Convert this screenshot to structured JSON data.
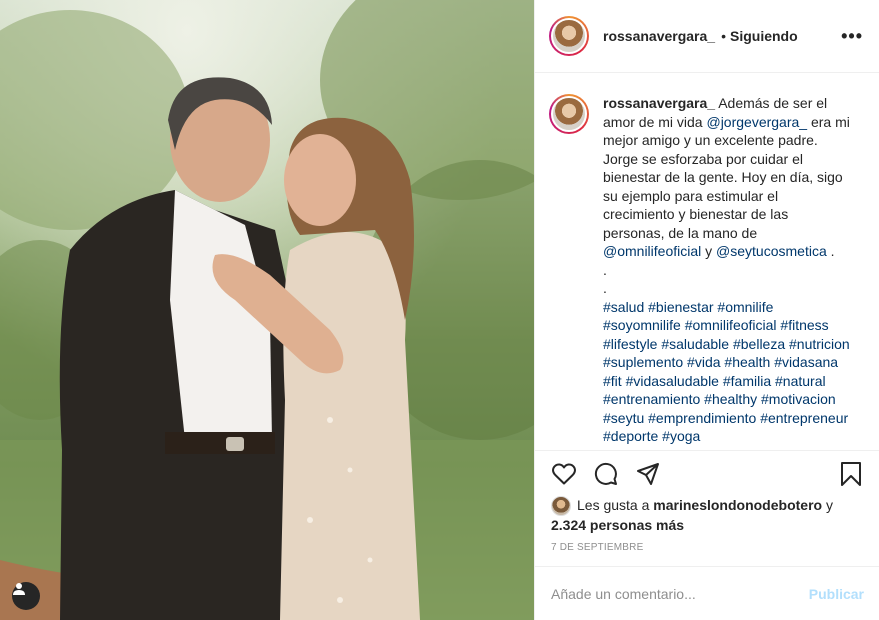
{
  "post": {
    "username": "rossanavergara_",
    "separator": "•",
    "follow_status": "Siguiendo",
    "more_label": "•••"
  },
  "caption": {
    "username": "rossanavergara_",
    "text_1": " Además de ser el amor de mi vida ",
    "mention_1": "@jorgevergara_",
    "text_2": " era mi mejor amigo y un excelente padre. Jorge se esforzaba por cuidar el bienestar de la gente. Hoy en día, sigo su ejemplo para estimular el crecimiento y bienestar de las personas, de la mano de ",
    "mention_2": "@omnilifeoficial",
    "text_3": " y ",
    "mention_3": "@seytucosmetica",
    "text_4": " .",
    "dot_1": ".",
    "dot_2": ".",
    "hashtags": "#salud #bienestar #omnilife #soyomnilife #omnilifeoficial #fitness #lifestyle #saludable #belleza #nutricion #suplemento #vida #health #vidasana #fit #vidasaludable #familia #natural #entrenamiento #healthy #motivacion #seytu #emprendimiento #entrepreneur #deporte #yoga"
  },
  "actions": {
    "like_icon": "heart-icon",
    "comment_icon": "comment-icon",
    "share_icon": "paper-plane-icon",
    "save_icon": "bookmark-icon"
  },
  "likes": {
    "prefix": "Les gusta a ",
    "liker": "marineslondonodebotero",
    "connector": " y ",
    "others": "2.324 personas más"
  },
  "date": "7 de septiembre",
  "comment": {
    "placeholder": "Añade un comentario...",
    "post_label": "Publicar"
  },
  "colors": {
    "link": "#00376b",
    "post_disabled": "#b2dffc",
    "muted": "#8e8e8e"
  }
}
